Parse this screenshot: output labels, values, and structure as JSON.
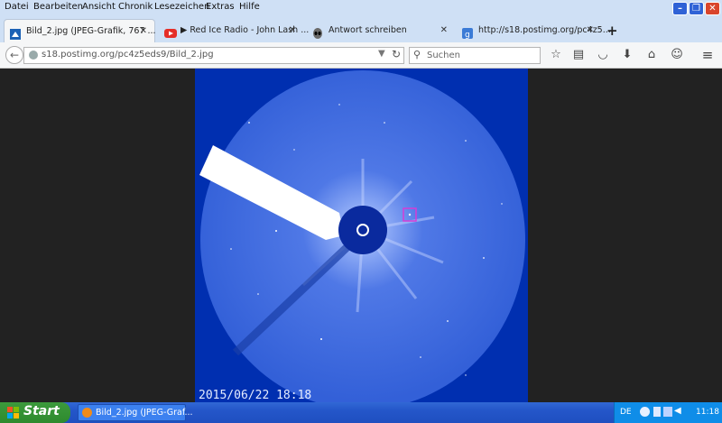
{
  "menubar": {
    "items": [
      "Datei",
      "Bearbeiten",
      "Ansicht",
      "Chronik",
      "Lesezeichen",
      "Extras",
      "Hilfe"
    ]
  },
  "tabs": [
    {
      "label": "Bild_2.jpg (JPEG-Grafik, 767 ...",
      "icon": "image-icon",
      "active": true
    },
    {
      "label": "▶ Red Ice Radio - John Lash ...",
      "icon": "youtube-icon",
      "active": false
    },
    {
      "label": "Antwort schreiben",
      "icon": "alien-icon",
      "active": false
    },
    {
      "label": "http://s18.postimg.org/pc4z5...",
      "icon": "page-icon",
      "active": false
    }
  ],
  "newtab": "+",
  "navbar": {
    "url": "s18.postimg.org/pc4z5eds9/Bild_2.jpg",
    "search_placeholder": "Suchen"
  },
  "image": {
    "timestamp": "2015/06/22  18:18"
  },
  "taskbar": {
    "start_label": "Start",
    "task_label": "Bild_2.jpg (JPEG-Graf...",
    "lang": "DE",
    "clock": "11:18"
  }
}
